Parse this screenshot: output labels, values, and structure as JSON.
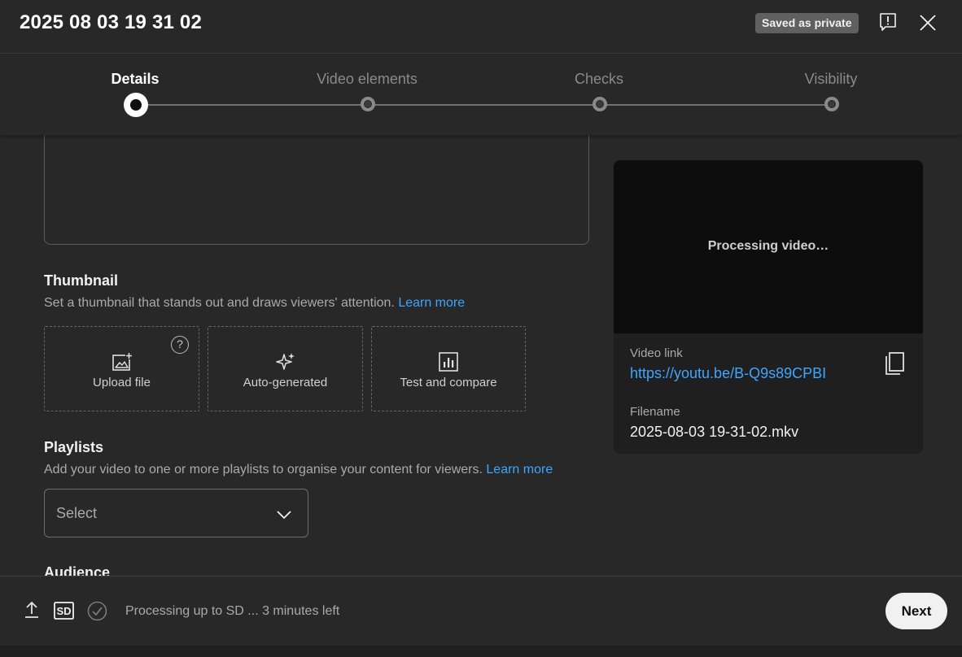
{
  "header": {
    "title": "2025 08 03 19 31 02",
    "saved_badge": "Saved as private",
    "feedback_icon": "feedback-icon",
    "close_icon": "close-icon"
  },
  "stepper": {
    "steps": [
      {
        "label": "Details",
        "active": true
      },
      {
        "label": "Video elements",
        "active": false
      },
      {
        "label": "Checks",
        "active": false
      },
      {
        "label": "Visibility",
        "active": false
      }
    ]
  },
  "thumbnail": {
    "title": "Thumbnail",
    "description": "Set a thumbnail that stands out and draws viewers' attention.",
    "learn_more": "Learn more",
    "options": [
      {
        "label": "Upload file",
        "icon": "add-photo-icon",
        "help": "?"
      },
      {
        "label": "Auto-generated",
        "icon": "sparkle-icon"
      },
      {
        "label": "Test and compare",
        "icon": "bar-chart-icon"
      }
    ]
  },
  "playlists": {
    "title": "Playlists",
    "description": "Add your video to one or more playlists to organise your content for viewers.",
    "learn_more": "Learn more",
    "select_value": "Select"
  },
  "audience": {
    "title": "Audience"
  },
  "side_panel": {
    "processing_text": "Processing video…",
    "video_link_label": "Video link",
    "video_link": "https://youtu.be/B-Q9s89CPBI",
    "filename_label": "Filename",
    "filename": "2025-08-03 19-31-02.mkv"
  },
  "footer": {
    "status": "Processing up to SD ... 3 minutes left",
    "sd_badge": "SD",
    "next_label": "Next"
  },
  "colors": {
    "background": "#282828",
    "link": "#3ea6ff",
    "text": "#f1f1f1",
    "muted": "#aaaaaa"
  }
}
